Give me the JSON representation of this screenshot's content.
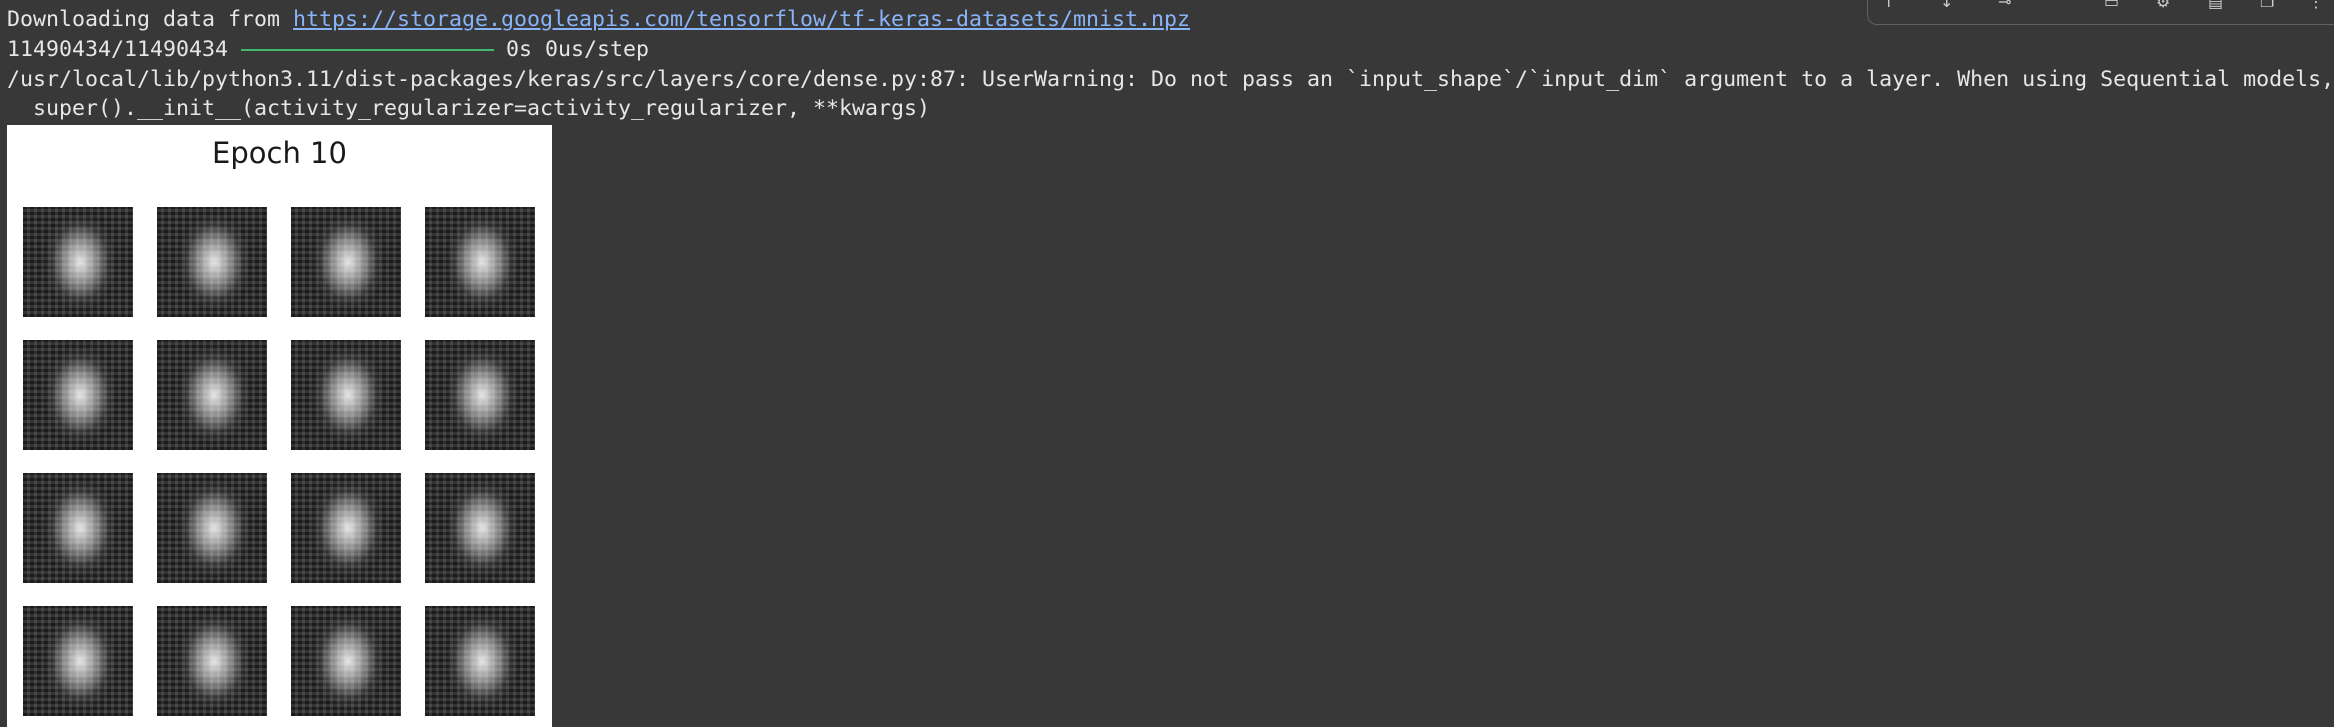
{
  "output": {
    "download_prefix": "Downloading data from ",
    "download_url": "https://storage.googleapis.com/tensorflow/tf-keras-datasets/mnist.npz",
    "progress_counts": "11490434/11490434",
    "progress_timing": "0s 0us/step",
    "progress_fraction": 1.0,
    "warning_line": "/usr/local/lib/python3.11/dist-packages/keras/src/layers/core/dense.py:87: UserWarning: Do not pass an `input_shape`/`input_dim` argument to a layer. When using Sequential models, pref",
    "super_line": "  super().__init__(activity_regularizer=activity_regularizer, **kwargs)"
  },
  "figure": {
    "title": "Epoch 10",
    "rows": 4,
    "cols": 4
  },
  "toolbar": {
    "icons": [
      "arrow-up-icon",
      "arrow-down-icon",
      "link-icon",
      "comment-icon",
      "settings-icon",
      "mirror-cell-icon",
      "copy-icon",
      "more-vert-icon"
    ]
  },
  "colors": {
    "background": "#383838",
    "link": "#8ab4f8",
    "progress": "#3fb96b",
    "text": "#e6e6e6"
  }
}
